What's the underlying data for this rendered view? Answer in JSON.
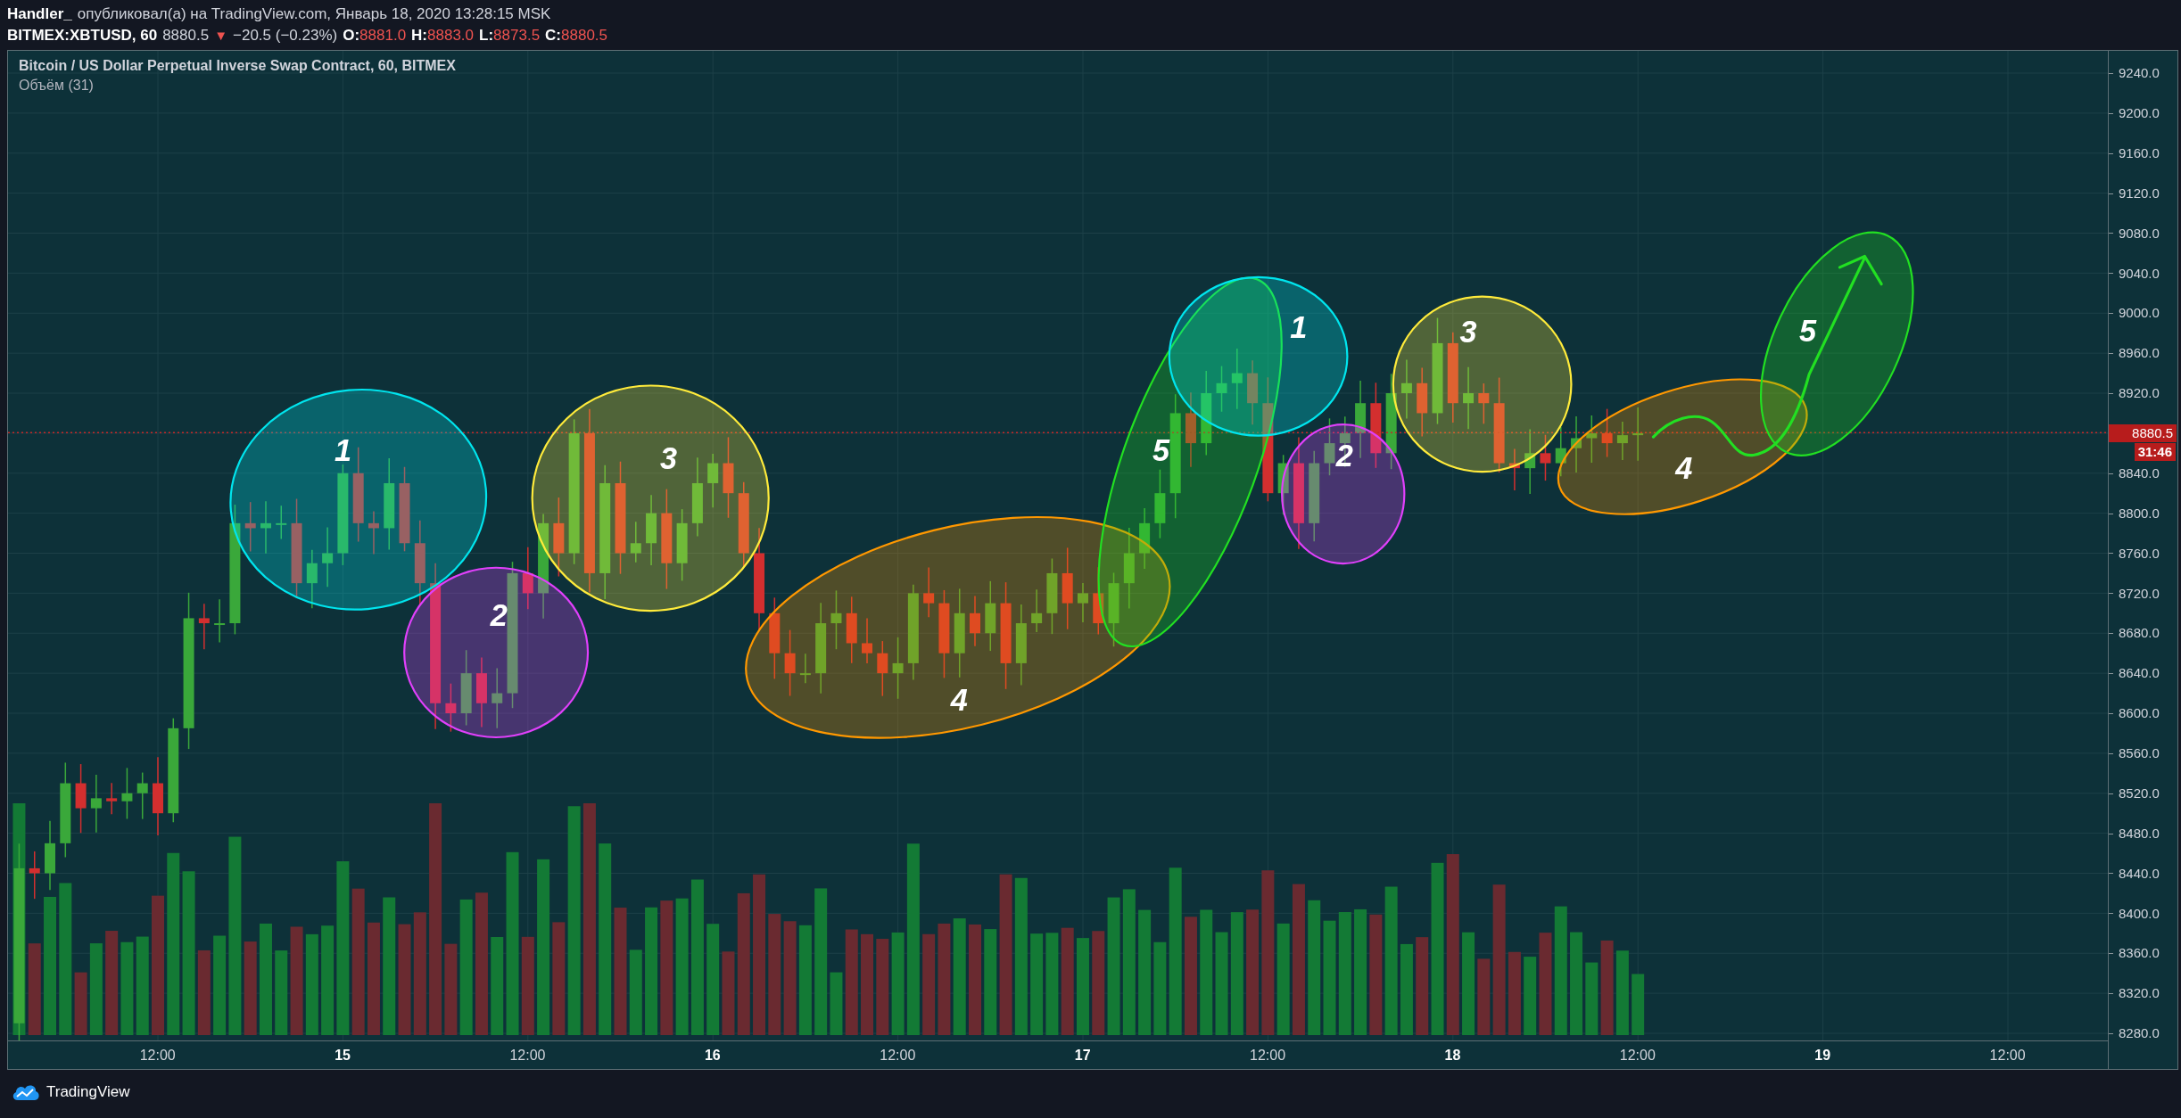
{
  "header": {
    "author": "Handler_",
    "published": "опубликовал(а) на TradingView.com, Январь 18, 2020 13:28:15 MSK"
  },
  "quote": {
    "symbol": "BITMEX:XBTUSD, 60",
    "last": "8880.5",
    "direction": "▼",
    "change": "−20.5 (−0.23%)",
    "ohlc": [
      {
        "key": "O:",
        "value": "8881.0"
      },
      {
        "key": "H:",
        "value": "8883.0"
      },
      {
        "key": "L:",
        "value": "8873.5"
      },
      {
        "key": "C:",
        "value": "8880.5"
      }
    ]
  },
  "legend": {
    "title": "Bitcoin / US Dollar Perpetual Inverse Swap Contract, 60, BITMEX",
    "indicator": "Объём (31)"
  },
  "price_axis": {
    "ticks": [
      {
        "kind": "tick",
        "label": "9240.0"
      },
      {
        "kind": "tick",
        "label": "9200.0"
      },
      {
        "kind": "tick",
        "label": "9160.0"
      },
      {
        "kind": "tick",
        "label": "9120.0"
      },
      {
        "kind": "tick",
        "label": "9080.0"
      },
      {
        "kind": "tick",
        "label": "9040.0"
      },
      {
        "kind": "tick",
        "label": "9000.0"
      },
      {
        "kind": "tick",
        "label": "8960.0"
      },
      {
        "kind": "tick",
        "label": "8920.0"
      },
      {
        "kind": "last",
        "label": "8880.5",
        "countdown": "31:46"
      },
      {
        "kind": "tick",
        "label": "8840.0"
      },
      {
        "kind": "tick",
        "label": "8800.0"
      },
      {
        "kind": "tick",
        "label": "8760.0"
      },
      {
        "kind": "tick",
        "label": "8720.0"
      },
      {
        "kind": "tick",
        "label": "8680.0"
      },
      {
        "kind": "tick",
        "label": "8640.0"
      },
      {
        "kind": "tick",
        "label": "8600.0"
      },
      {
        "kind": "tick",
        "label": "8560.0"
      },
      {
        "kind": "tick",
        "label": "8520.0"
      },
      {
        "kind": "tick",
        "label": "8480.0"
      },
      {
        "kind": "tick",
        "label": "8440.0"
      },
      {
        "kind": "tick",
        "label": "8400.0"
      },
      {
        "kind": "tick",
        "label": "8360.0"
      },
      {
        "kind": "tick",
        "label": "8320.0"
      },
      {
        "kind": "tick",
        "label": "8280.0"
      }
    ]
  },
  "time_axis": {
    "ticks": [
      {
        "kind": "time",
        "label": "12:00"
      },
      {
        "kind": "day",
        "label": "15"
      },
      {
        "kind": "time",
        "label": "12:00"
      },
      {
        "kind": "day",
        "label": "16"
      },
      {
        "kind": "time",
        "label": "12:00"
      },
      {
        "kind": "day",
        "label": "17"
      },
      {
        "kind": "time",
        "label": "12:00"
      },
      {
        "kind": "day",
        "label": "18"
      },
      {
        "kind": "time",
        "label": "12:00"
      },
      {
        "kind": "day",
        "label": "19"
      },
      {
        "kind": "time",
        "label": "12:00"
      }
    ]
  },
  "annotations": [
    {
      "label": "1",
      "color": "#00e5ee"
    },
    {
      "label": "2",
      "color": "#e040fb"
    },
    {
      "label": "3",
      "color": "#ffeb3b"
    },
    {
      "label": "4",
      "color": "#ff9800"
    },
    {
      "label": "5",
      "color": "#22e022"
    },
    {
      "label": "1",
      "color": "#00e5ee"
    },
    {
      "label": "2",
      "color": "#e040fb"
    },
    {
      "label": "3",
      "color": "#ffeb3b"
    },
    {
      "label": "4",
      "color": "#ff9800"
    },
    {
      "label": "5",
      "color": "#22e022"
    }
  ],
  "footer": {
    "brand": "TradingView"
  }
}
